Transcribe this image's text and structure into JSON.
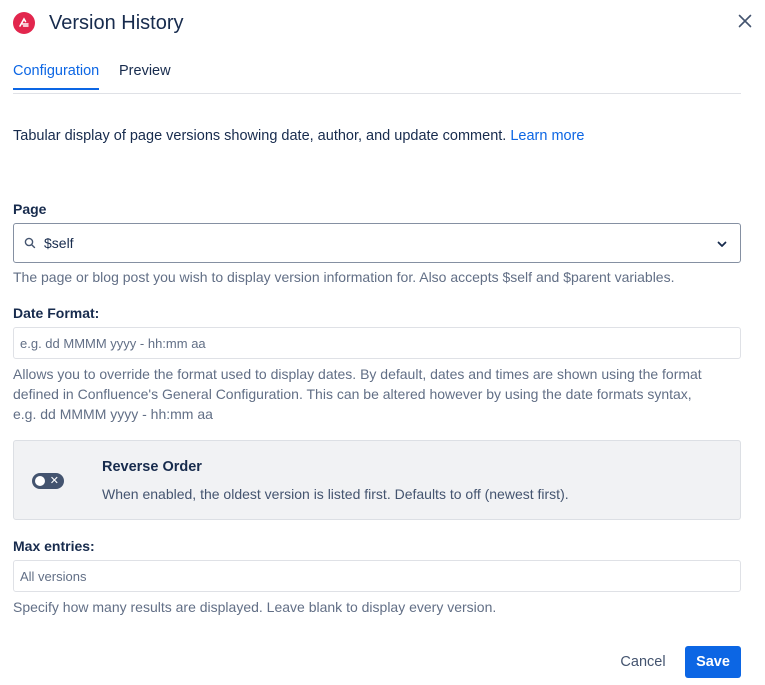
{
  "dialog": {
    "title": "Version History",
    "close_icon": "close-icon",
    "logo_icon": "app-logo-icon",
    "brand_color": "#e2264d"
  },
  "tabs": [
    {
      "label": "Configuration",
      "active": true
    },
    {
      "label": "Preview",
      "active": false
    }
  ],
  "description": {
    "text": "Tabular display of page versions showing date, author, and update comment.",
    "link": "Learn more"
  },
  "page_field": {
    "label": "Page",
    "value": "$self",
    "help": "The page or blog post you wish to display version information for. Also accepts $self and $parent variables."
  },
  "date_format": {
    "label": "Date Format:",
    "placeholder": "e.g. dd MMMM yyyy - hh:mm aa",
    "help_lines": [
      "Allows you to override the format used to display dates. By default, dates and times are shown using the format",
      "defined in Confluence's General Configuration. This can be altered however by using the date formats syntax,",
      "e.g. dd MMMM yyyy - hh:mm aa"
    ]
  },
  "reverse_order": {
    "title": "Reverse Order",
    "description": "When enabled, the oldest version is listed first. Defaults to off (newest first).",
    "enabled": false
  },
  "max_entries": {
    "label": "Max entries:",
    "placeholder": "All versions",
    "help": "Specify how many results are displayed. Leave blank to display every version."
  },
  "footer": {
    "cancel_label": "Cancel",
    "save_label": "Save",
    "accent_color": "#0c66e4"
  }
}
